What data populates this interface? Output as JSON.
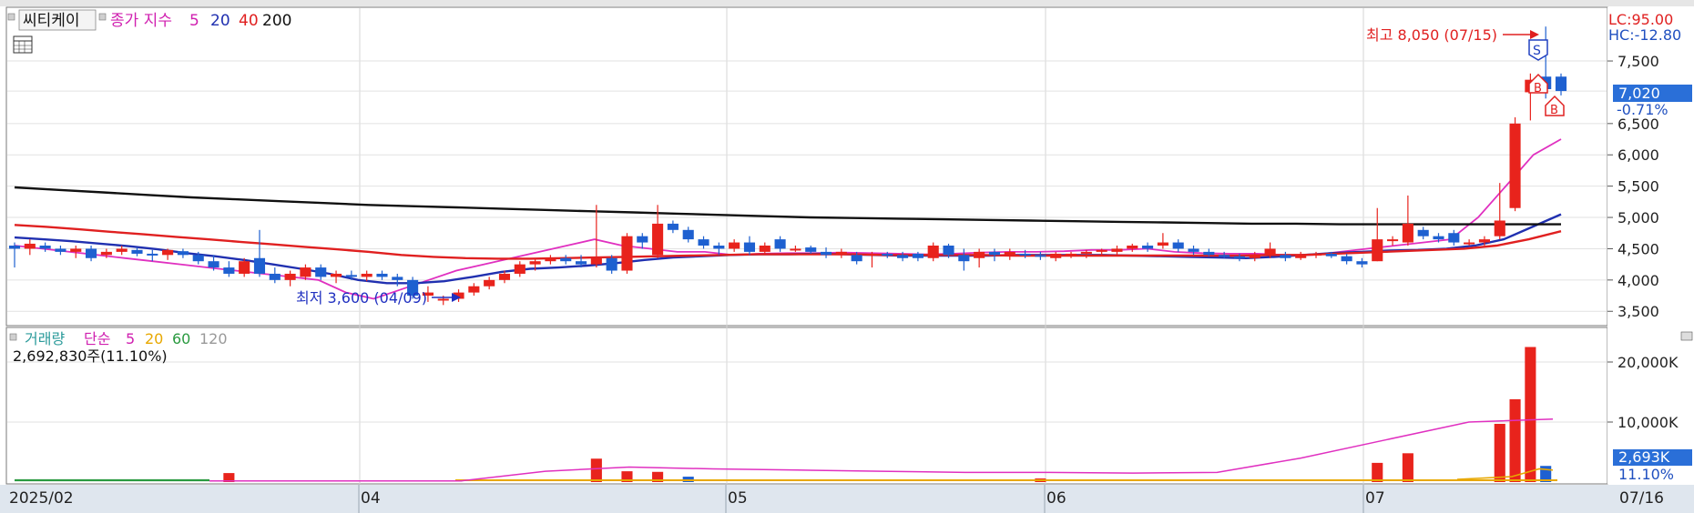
{
  "chart_data": [
    {
      "type": "candlestick",
      "panel": "price",
      "stock_name": "씨티케이",
      "legend": {
        "label": "종가 지수",
        "periods": [
          "5",
          "20",
          "40",
          "200"
        ]
      },
      "y_ticks": [
        "7,500",
        "7,020",
        "6,500",
        "6,000",
        "5,500",
        "5,000",
        "4,500",
        "4,000",
        "3,500"
      ],
      "x_ticks": [
        "2025/02",
        "04",
        "05",
        "06",
        "07",
        "07/16"
      ],
      "last_price": "7,020",
      "change_pct": "-0.71%",
      "lc_label": "LC:95.00",
      "hc_label": "HC:-12.80",
      "high_annotation": "최고 8,050 (07/15)",
      "low_annotation": "최저 3,600 (04/09)",
      "signals": [
        "S",
        "B",
        "B"
      ],
      "ylim": [
        3300,
        8300
      ],
      "candles": [
        [
          4550,
          4600,
          4200,
          4500
        ],
        [
          4500,
          4650,
          4400,
          4580
        ],
        [
          4550,
          4600,
          4450,
          4500
        ],
        [
          4500,
          4550,
          4400,
          4450
        ],
        [
          4450,
          4550,
          4350,
          4500
        ],
        [
          4500,
          4550,
          4300,
          4350
        ],
        [
          4400,
          4500,
          4350,
          4450
        ],
        [
          4450,
          4550,
          4400,
          4500
        ],
        [
          4480,
          4520,
          4380,
          4420
        ],
        [
          4420,
          4480,
          4300,
          4400
        ],
        [
          4400,
          4500,
          4320,
          4480
        ],
        [
          4460,
          4500,
          4350,
          4400
        ],
        [
          4400,
          4450,
          4250,
          4300
        ],
        [
          4300,
          4400,
          4150,
          4200
        ],
        [
          4200,
          4300,
          4050,
          4100
        ],
        [
          4100,
          4350,
          4050,
          4300
        ],
        [
          4350,
          4800,
          4050,
          4100
        ],
        [
          4100,
          4200,
          3950,
          4000
        ],
        [
          4000,
          4150,
          3900,
          4100
        ],
        [
          4050,
          4250,
          4000,
          4200
        ],
        [
          4200,
          4250,
          4000,
          4050
        ],
        [
          4050,
          4150,
          3950,
          4100
        ],
        [
          4080,
          4150,
          4000,
          4050
        ],
        [
          4050,
          4150,
          3980,
          4100
        ],
        [
          4100,
          4150,
          4000,
          4050
        ],
        [
          4050,
          4100,
          3900,
          4000
        ],
        [
          4000,
          4050,
          3700,
          3750
        ],
        [
          3750,
          3900,
          3650,
          3800
        ],
        [
          3700,
          3750,
          3600,
          3700
        ],
        [
          3700,
          3850,
          3650,
          3800
        ],
        [
          3800,
          3950,
          3750,
          3900
        ],
        [
          3900,
          4050,
          3850,
          4000
        ],
        [
          4000,
          4150,
          3950,
          4100
        ],
        [
          4100,
          4300,
          4050,
          4250
        ],
        [
          4250,
          4350,
          4150,
          4300
        ],
        [
          4300,
          4400,
          4250,
          4350
        ],
        [
          4350,
          4400,
          4250,
          4300
        ],
        [
          4300,
          4400,
          4200,
          4250
        ],
        [
          4250,
          5200,
          4200,
          4350
        ],
        [
          4350,
          4400,
          4100,
          4150
        ],
        [
          4150,
          4750,
          4100,
          4700
        ],
        [
          4700,
          4750,
          4500,
          4600
        ],
        [
          4400,
          5200,
          4350,
          4900
        ],
        [
          4900,
          4950,
          4750,
          4800
        ],
        [
          4800,
          4850,
          4600,
          4650
        ],
        [
          4650,
          4700,
          4500,
          4550
        ],
        [
          4550,
          4600,
          4400,
          4500
        ],
        [
          4500,
          4650,
          4450,
          4600
        ],
        [
          4600,
          4700,
          4400,
          4450
        ],
        [
          4450,
          4600,
          4400,
          4550
        ],
        [
          4650,
          4700,
          4450,
          4500
        ],
        [
          4500,
          4550,
          4450,
          4500
        ],
        [
          4520,
          4550,
          4420,
          4450
        ],
        [
          4450,
          4520,
          4350,
          4400
        ],
        [
          4400,
          4500,
          4350,
          4450
        ],
        [
          4400,
          4450,
          4250,
          4300
        ],
        [
          4400,
          4450,
          4200,
          4420
        ],
        [
          4420,
          4450,
          4350,
          4400
        ],
        [
          4400,
          4450,
          4300,
          4350
        ],
        [
          4420,
          4450,
          4300,
          4350
        ],
        [
          4350,
          4600,
          4300,
          4550
        ],
        [
          4550,
          4580,
          4350,
          4400
        ],
        [
          4400,
          4500,
          4150,
          4300
        ],
        [
          4350,
          4500,
          4200,
          4450
        ],
        [
          4450,
          4500,
          4300,
          4400
        ],
        [
          4400,
          4500,
          4320,
          4450
        ],
        [
          4420,
          4480,
          4350,
          4400
        ],
        [
          4400,
          4450,
          4320,
          4380
        ],
        [
          4350,
          4450,
          4300,
          4420
        ],
        [
          4400,
          4450,
          4350,
          4420
        ],
        [
          4420,
          4480,
          4350,
          4450
        ],
        [
          4450,
          4500,
          4380,
          4480
        ],
        [
          4450,
          4550,
          4400,
          4500
        ],
        [
          4500,
          4580,
          4450,
          4550
        ],
        [
          4550,
          4600,
          4450,
          4500
        ],
        [
          4550,
          4750,
          4500,
          4600
        ],
        [
          4600,
          4650,
          4450,
          4500
        ],
        [
          4500,
          4550,
          4400,
          4450
        ],
        [
          4450,
          4500,
          4380,
          4400
        ],
        [
          4400,
          4450,
          4350,
          4380
        ],
        [
          4380,
          4420,
          4300,
          4350
        ],
        [
          4350,
          4450,
          4300,
          4400
        ],
        [
          4400,
          4600,
          4350,
          4500
        ],
        [
          4400,
          4450,
          4300,
          4350
        ],
        [
          4350,
          4450,
          4320,
          4400
        ],
        [
          4400,
          4450,
          4350,
          4420
        ],
        [
          4420,
          4450,
          4350,
          4380
        ],
        [
          4380,
          4420,
          4250,
          4300
        ],
        [
          4300,
          4350,
          4200,
          4250
        ],
        [
          4300,
          5150,
          4300,
          4650
        ],
        [
          4650,
          4700,
          4550,
          4650
        ],
        [
          4600,
          5350,
          4550,
          4900
        ],
        [
          4800,
          4850,
          4650,
          4700
        ],
        [
          4700,
          4750,
          4600,
          4650
        ],
        [
          4750,
          4800,
          4550,
          4600
        ],
        [
          4600,
          4650,
          4550,
          4600
        ],
        [
          4600,
          4700,
          4550,
          4650
        ],
        [
          4700,
          5550,
          4650,
          4950
        ],
        [
          5150,
          6600,
          5100,
          6500
        ],
        [
          7000,
          7300,
          6550,
          7200
        ],
        [
          7250,
          8050,
          6900,
          7050
        ],
        [
          7250,
          7300,
          6950,
          7020
        ]
      ],
      "ma": [
        {
          "name": "5",
          "color": "#e030c0",
          "values": [
            4550,
            4500,
            4450,
            4400,
            4350,
            4300,
            4250,
            4200,
            4150,
            4100,
            4050,
            4000,
            3800,
            3700,
            3850,
            4000,
            4150,
            4250,
            4350,
            4450,
            4550,
            4650,
            4550,
            4500,
            4450,
            4450,
            4400,
            4420,
            4430,
            4430,
            4440,
            4430,
            4420,
            4410,
            4420,
            4440,
            4450,
            4450,
            4460,
            4480,
            4480,
            4500,
            4450,
            4430,
            4420,
            4420,
            4400,
            4400,
            4450,
            4500,
            4550,
            4600,
            4650,
            5000,
            5500,
            6000,
            6250
          ]
        },
        {
          "name": "20",
          "color": "#2030b0",
          "values": [
            4680,
            4650,
            4620,
            4580,
            4540,
            4490,
            4430,
            4380,
            4320,
            4250,
            4180,
            4100,
            4000,
            3950,
            3950,
            3980,
            4050,
            4130,
            4180,
            4200,
            4230,
            4270,
            4320,
            4360,
            4380,
            4400,
            4410,
            4410,
            4420,
            4410,
            4400,
            4390,
            4390,
            4390,
            4390,
            4400,
            4400,
            4400,
            4400,
            4390,
            4380,
            4370,
            4360,
            4350,
            4370,
            4400,
            4430,
            4450,
            4470,
            4480,
            4500,
            4550,
            4650,
            4850,
            5050
          ]
        },
        {
          "name": "40",
          "color": "#e02020",
          "values": [
            4880,
            4850,
            4810,
            4770,
            4730,
            4690,
            4650,
            4610,
            4570,
            4530,
            4490,
            4450,
            4400,
            4370,
            4350,
            4340,
            4340,
            4350,
            4360,
            4370,
            4380,
            4390,
            4400,
            4410,
            4410,
            4410,
            4410,
            4400,
            4400,
            4400,
            4400,
            4390,
            4390,
            4390,
            4390,
            4390,
            4390,
            4390,
            4390,
            4400,
            4400,
            4420,
            4440,
            4460,
            4480,
            4500,
            4550,
            4650,
            4780
          ]
        },
        {
          "name": "200",
          "color": "#101010",
          "values": [
            5480,
            5440,
            5400,
            5360,
            5320,
            5290,
            5260,
            5230,
            5200,
            5180,
            5160,
            5140,
            5120,
            5100,
            5080,
            5060,
            5040,
            5020,
            5000,
            4990,
            4980,
            4970,
            4960,
            4950,
            4940,
            4930,
            4920,
            4910,
            4900,
            4900,
            4890,
            4890,
            4890,
            4890,
            4890,
            4890
          ]
        }
      ]
    },
    {
      "type": "bar",
      "panel": "volume",
      "title": "거래량",
      "legend": {
        "label": "단순",
        "periods": [
          "5",
          "20",
          "60",
          "120"
        ]
      },
      "current_volume": "2,692,830주(11.10%)",
      "last_volume": "2,693K",
      "volume_pct": "11.10%",
      "y_ticks": [
        "20,000K",
        "10,000K"
      ],
      "ylim": [
        0,
        25000
      ],
      "bars": [
        {
          "i": 14,
          "v": 1500,
          "up": true
        },
        {
          "i": 38,
          "v": 3900,
          "up": true
        },
        {
          "i": 40,
          "v": 1800,
          "up": true
        },
        {
          "i": 42,
          "v": 1700,
          "up": true
        },
        {
          "i": 44,
          "v": 900,
          "up": false
        },
        {
          "i": 67,
          "v": 600,
          "up": true
        },
        {
          "i": 89,
          "v": 3200,
          "up": true
        },
        {
          "i": 91,
          "v": 4800,
          "up": true
        },
        {
          "i": 97,
          "v": 9700,
          "up": true
        },
        {
          "i": 98,
          "v": 13800,
          "up": true
        },
        {
          "i": 99,
          "v": 22500,
          "up": true
        },
        {
          "i": 100,
          "v": 2693,
          "up": false
        }
      ],
      "ma5": [
        200,
        200,
        200,
        200,
        1800,
        2500,
        2200,
        2000,
        1800,
        1600,
        1600,
        1500,
        1600,
        4000,
        7000,
        10000,
        10500
      ]
    }
  ]
}
